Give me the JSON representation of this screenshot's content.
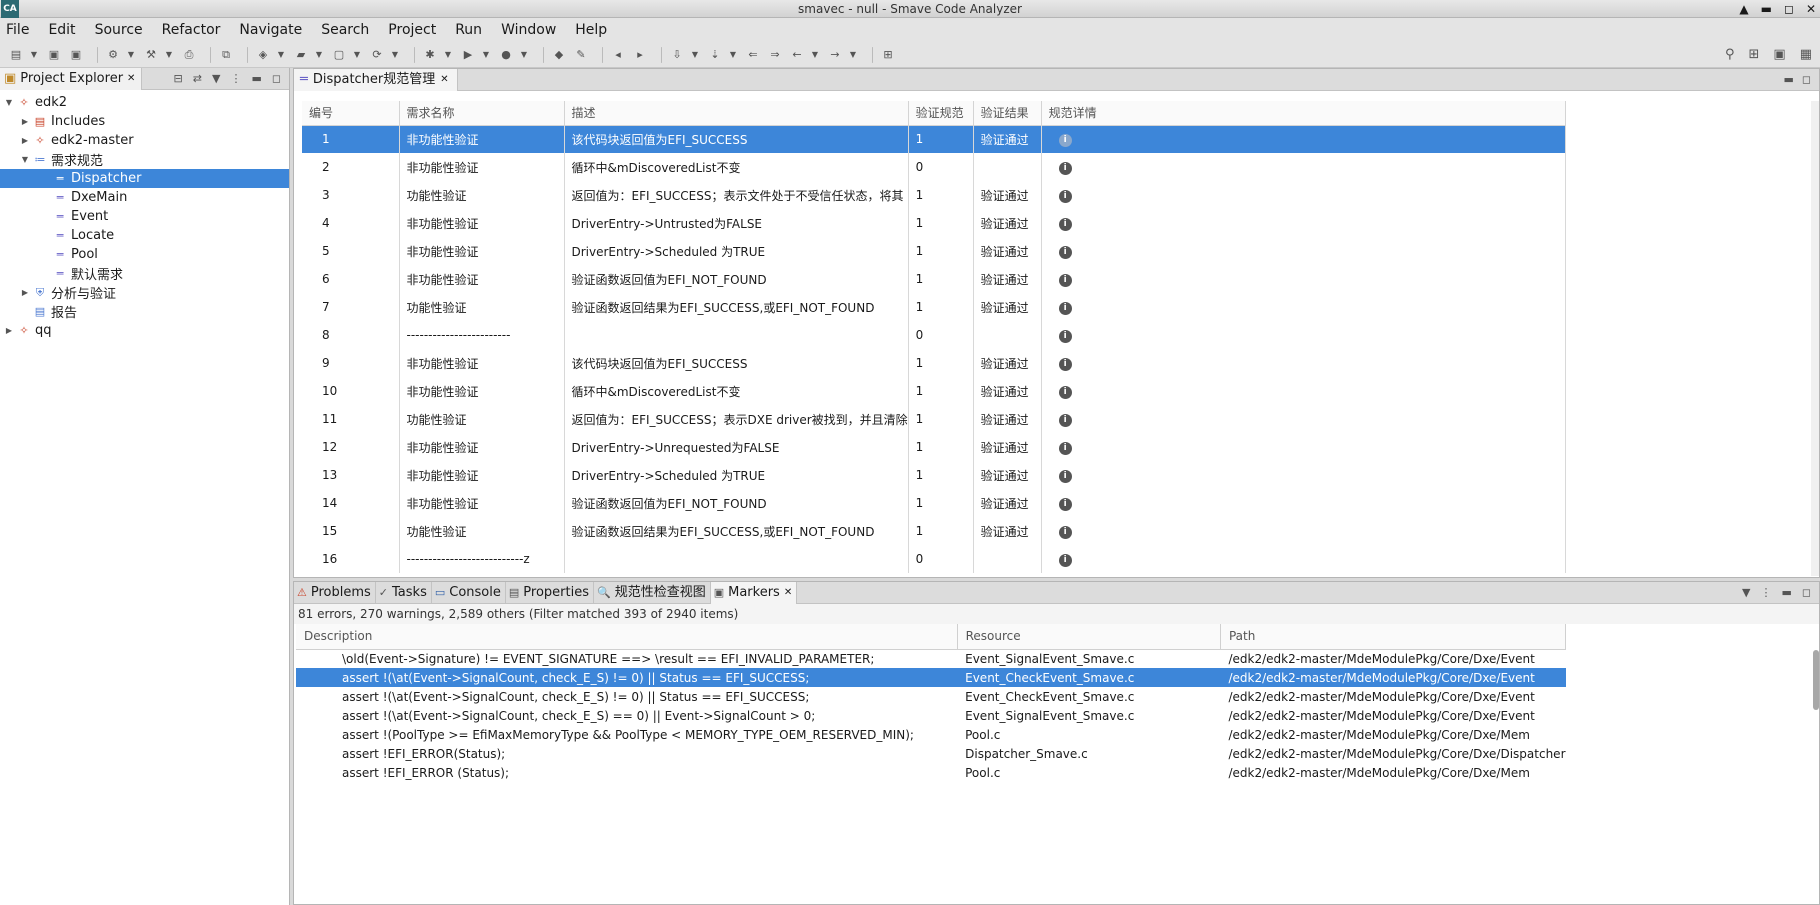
{
  "window": {
    "title": "smavec - null - Smave Code Analyzer",
    "app_icon": "CA"
  },
  "menu": [
    "File",
    "Edit",
    "Source",
    "Refactor",
    "Navigate",
    "Search",
    "Project",
    "Run",
    "Window",
    "Help"
  ],
  "project_explorer": {
    "tab_label": "Project Explorer",
    "tree": [
      {
        "label": "edk2",
        "depth": 0,
        "expanded": true,
        "icon": "project-icon"
      },
      {
        "label": "Includes",
        "depth": 1,
        "expanded": false,
        "icon": "includes-icon"
      },
      {
        "label": "edk2-master",
        "depth": 1,
        "expanded": false,
        "icon": "project-icon"
      },
      {
        "label": "需求规范",
        "depth": 1,
        "expanded": true,
        "icon": "requirements-icon"
      },
      {
        "label": "Dispatcher",
        "depth": 2,
        "selected": true,
        "icon": "spec-icon"
      },
      {
        "label": "DxeMain",
        "depth": 2,
        "icon": "spec-icon"
      },
      {
        "label": "Event",
        "depth": 2,
        "icon": "spec-icon"
      },
      {
        "label": "Locate",
        "depth": 2,
        "icon": "spec-icon"
      },
      {
        "label": "Pool",
        "depth": 2,
        "icon": "spec-icon"
      },
      {
        "label": "默认需求",
        "depth": 2,
        "icon": "spec-icon"
      },
      {
        "label": "分析与验证",
        "depth": 1,
        "expanded": false,
        "icon": "shield-icon"
      },
      {
        "label": "报告",
        "depth": 1,
        "icon": "report-icon"
      },
      {
        "label": "qq",
        "depth": 0,
        "expanded": false,
        "icon": "project-icon"
      }
    ]
  },
  "editor": {
    "tab_label": "Dispatcher规范管理",
    "columns": [
      "编号",
      "需求名称",
      "描述",
      "验证规范",
      "验证结果",
      "规范详情"
    ],
    "rows": [
      {
        "id": "1",
        "name": "非功能性验证",
        "desc": "该代码块返回值为EFI_SUCCESS",
        "spec": "1",
        "result": "验证通过",
        "selected": true
      },
      {
        "id": "2",
        "name": "非功能性验证",
        "desc": "循环中&mDiscoveredList不变",
        "spec": "0",
        "result": ""
      },
      {
        "id": "3",
        "name": "功能性验证",
        "desc": "返回值为：EFI_SUCCESS；表示文件处于不受信任状态，将其",
        "spec": "1",
        "result": "验证通过"
      },
      {
        "id": "4",
        "name": "非功能性验证",
        "desc": "DriverEntry->Untrusted为FALSE",
        "spec": "1",
        "result": "验证通过"
      },
      {
        "id": "5",
        "name": "非功能性验证",
        "desc": "DriverEntry->Scheduled 为TRUE",
        "spec": "1",
        "result": "验证通过"
      },
      {
        "id": "6",
        "name": "非功能性验证",
        "desc": "验证函数返回值为EFI_NOT_FOUND",
        "spec": "1",
        "result": "验证通过"
      },
      {
        "id": "7",
        "name": "功能性验证",
        "desc": "验证函数返回结果为EFI_SUCCESS,或EFI_NOT_FOUND",
        "spec": "1",
        "result": "验证通过"
      },
      {
        "id": "8",
        "name": "------------------------",
        "desc": "",
        "spec": "0",
        "result": ""
      },
      {
        "id": "9",
        "name": "非功能性验证",
        "desc": "该代码块返回值为EFI_SUCCESS",
        "spec": "1",
        "result": "验证通过"
      },
      {
        "id": "10",
        "name": "非功能性验证",
        "desc": "循环中&mDiscoveredList不变",
        "spec": "1",
        "result": "验证通过"
      },
      {
        "id": "11",
        "name": "功能性验证",
        "desc": "返回值为：EFI_SUCCESS；表示DXE driver被找到，并且清除",
        "spec": "1",
        "result": "验证通过"
      },
      {
        "id": "12",
        "name": "非功能性验证",
        "desc": "DriverEntry->Unrequested为FALSE",
        "spec": "1",
        "result": "验证通过"
      },
      {
        "id": "13",
        "name": "非功能性验证",
        "desc": "DriverEntry->Scheduled 为TRUE",
        "spec": "1",
        "result": "验证通过"
      },
      {
        "id": "14",
        "name": "非功能性验证",
        "desc": "验证函数返回值为EFI_NOT_FOUND",
        "spec": "1",
        "result": "验证通过"
      },
      {
        "id": "15",
        "name": "功能性验证",
        "desc": "验证函数返回结果为EFI_SUCCESS,或EFI_NOT_FOUND",
        "spec": "1",
        "result": "验证通过"
      },
      {
        "id": "16",
        "name": "---------------------------z",
        "desc": "",
        "spec": "0",
        "result": ""
      }
    ]
  },
  "bottom": {
    "tabs": [
      {
        "label": "Problems",
        "icon": "problems-icon"
      },
      {
        "label": "Tasks",
        "icon": "tasks-icon"
      },
      {
        "label": "Console",
        "icon": "console-icon"
      },
      {
        "label": "Properties",
        "icon": "properties-icon"
      },
      {
        "label": "规范性检查视图",
        "icon": "check-view-icon"
      },
      {
        "label": "Markers",
        "icon": "markers-icon",
        "active": true
      }
    ],
    "summary": "81 errors, 270 warnings, 2,589 others (Filter matched 393 of 2940 items)",
    "columns": [
      "Description",
      "Resource",
      "Path"
    ],
    "rows": [
      {
        "desc": "\\old(Event->Signature) != EVENT_SIGNATURE  ==> \\result == EFI_INVALID_PARAMETER;",
        "res": "Event_SignalEvent_Smave.c",
        "path": "/edk2/edk2-master/MdeModulePkg/Core/Dxe/Event"
      },
      {
        "desc": "assert !(\\at(Event->SignalCount, check_E_S) != 0) || Status == EFI_SUCCESS;",
        "res": "Event_CheckEvent_Smave.c",
        "path": "/edk2/edk2-master/MdeModulePkg/Core/Dxe/Event",
        "selected": true
      },
      {
        "desc": "assert !(\\at(Event->SignalCount, check_E_S) != 0) || Status == EFI_SUCCESS;",
        "res": "Event_CheckEvent_Smave.c",
        "path": "/edk2/edk2-master/MdeModulePkg/Core/Dxe/Event"
      },
      {
        "desc": "assert !(\\at(Event->SignalCount, check_E_S) == 0) || Event->SignalCount > 0;",
        "res": "Event_SignalEvent_Smave.c",
        "path": "/edk2/edk2-master/MdeModulePkg/Core/Dxe/Event"
      },
      {
        "desc": "assert !(PoolType >= EfiMaxMemoryType && PoolType < MEMORY_TYPE_OEM_RESERVED_MIN);",
        "res": "Pool.c",
        "path": "/edk2/edk2-master/MdeModulePkg/Core/Dxe/Mem"
      },
      {
        "desc": "assert !EFI_ERROR(Status);",
        "res": "Dispatcher_Smave.c",
        "path": "/edk2/edk2-master/MdeModulePkg/Core/Dxe/Dispatcher"
      },
      {
        "desc": "assert !EFI_ERROR (Status);",
        "res": "Pool.c",
        "path": "/edk2/edk2-master/MdeModulePkg/Core/Dxe/Mem"
      }
    ]
  },
  "colors": {
    "selection": "#3d86d9"
  }
}
